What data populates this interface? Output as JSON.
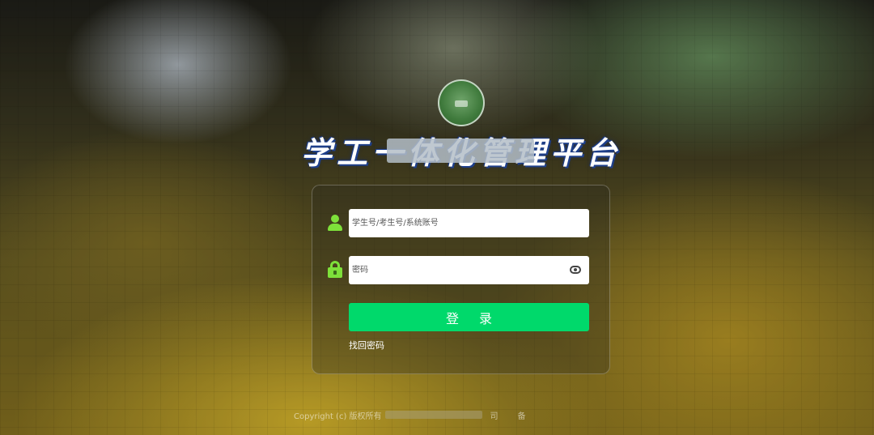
{
  "page": {
    "title": "学工一体化管理平台"
  },
  "login": {
    "account_placeholder": "学生号/考生号/系统账号",
    "password_placeholder": "密码",
    "login_button_label": "登 录",
    "forgot_password_label": "找回密码"
  },
  "footer": {
    "copyright_text": "Copyright (c) 版权所有",
    "suffix_a": "司",
    "suffix_b": "备"
  },
  "colors": {
    "accent": "#00d96b",
    "icon_green": "#7ee03a",
    "title_outline": "#1e3f8a"
  },
  "icons": {
    "account": "user-icon",
    "password": "lock-icon",
    "toggle_password": "eye-icon"
  }
}
